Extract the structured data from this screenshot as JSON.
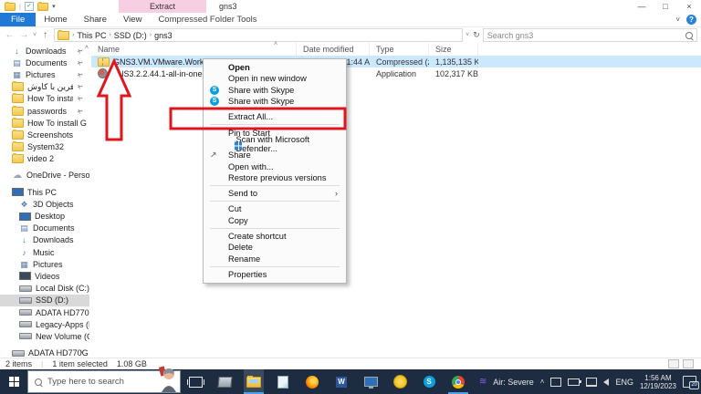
{
  "window": {
    "title": "gns3",
    "minimize": "—",
    "maximize": "□",
    "close": "×"
  },
  "titlebar": {
    "contextual_tab_group": "Extract"
  },
  "ribbon": {
    "tabs": {
      "file": "File",
      "home": "Home",
      "share": "Share",
      "view": "View",
      "cft": "Compressed Folder Tools"
    },
    "help": "?"
  },
  "addressbar": {
    "breadcrumb": {
      "root": "This PC",
      "drive": "SSD (D:)",
      "folder": "gns3"
    },
    "search_placeholder": "Search gns3"
  },
  "sidebar": {
    "quick_access": [
      {
        "label": "Downloads",
        "pinned": true
      },
      {
        "label": "Documents",
        "pinned": true
      },
      {
        "label": "Pictures",
        "pinned": true
      },
      {
        "label": "آفرین با کاوش",
        "pinned": true
      },
      {
        "label": "How To instal",
        "pinned": true
      },
      {
        "label": "passwords",
        "pinned": true
      },
      {
        "label": "How To install G",
        "pinned": false
      },
      {
        "label": "Screenshots",
        "pinned": false
      },
      {
        "label": "System32",
        "pinned": false
      },
      {
        "label": "video 2",
        "pinned": false
      }
    ],
    "onedrive": {
      "label": "OneDrive - Person"
    },
    "this_pc": {
      "label": "This PC",
      "children": [
        {
          "label": "3D Objects"
        },
        {
          "label": "Desktop"
        },
        {
          "label": "Documents"
        },
        {
          "label": "Downloads"
        },
        {
          "label": "Music"
        },
        {
          "label": "Pictures"
        },
        {
          "label": "Videos"
        },
        {
          "label": "Local Disk (C:)"
        },
        {
          "label": "SSD (D:)",
          "selected": true
        },
        {
          "label": "ADATA HD770G"
        },
        {
          "label": "Legacy-Apps (F:"
        },
        {
          "label": "New Volume (G:"
        }
      ]
    },
    "bottom_item": {
      "label": "ADATA HD770G (E"
    }
  },
  "files": {
    "columns": {
      "name": "Name",
      "date": "Date modified",
      "type": "Type",
      "size": "Size"
    },
    "rows": [
      {
        "name": "GNS3.VM.VMware.Workstation.2.2.44.1",
        "date": "12/19/2023 1:44 AM",
        "type": "Compressed (zipp...",
        "size": "1,135,135 KB",
        "selected": true
      },
      {
        "name": "GNS3.2.2.44.1-all-in-one-dach",
        "date": "M",
        "type": "Application",
        "size": "102,317 KB",
        "selected": false
      }
    ]
  },
  "context_menu": {
    "items": [
      {
        "label": "Open"
      },
      {
        "label": "Open in new window"
      },
      {
        "label": "Share with Skype"
      },
      {
        "label": "Share with Skype"
      },
      {
        "label": "Extract All..."
      },
      {
        "label": "Pin to Start"
      },
      {
        "label": "Scan with Microsoft Defender..."
      },
      {
        "label": "Share"
      },
      {
        "label": "Open with..."
      },
      {
        "label": "Restore previous versions"
      },
      {
        "label": "Send to"
      },
      {
        "label": "Cut"
      },
      {
        "label": "Copy"
      },
      {
        "label": "Create shortcut"
      },
      {
        "label": "Delete"
      },
      {
        "label": "Rename"
      },
      {
        "label": "Properties"
      }
    ],
    "skype_initial": "S"
  },
  "statusbar": {
    "item_count": "2 items",
    "selection": "1 item selected",
    "selection_size": "1.08 GB"
  },
  "taskbar": {
    "search_placeholder": "Type here to search",
    "word_initial": "W",
    "skype_initial": "S",
    "tray": {
      "air_quality": "Air: Severe",
      "language": "ENG",
      "time": "1:56 AM",
      "date": "12/19/2023",
      "notification_count": "20"
    }
  },
  "colors": {
    "annotation_red": "#e0161f",
    "selection_blue": "#cce8ff",
    "contextual_pink": "#f7cfe3",
    "taskbar_navy": "#1d2c40",
    "accent_blue": "#1e7ad6"
  }
}
